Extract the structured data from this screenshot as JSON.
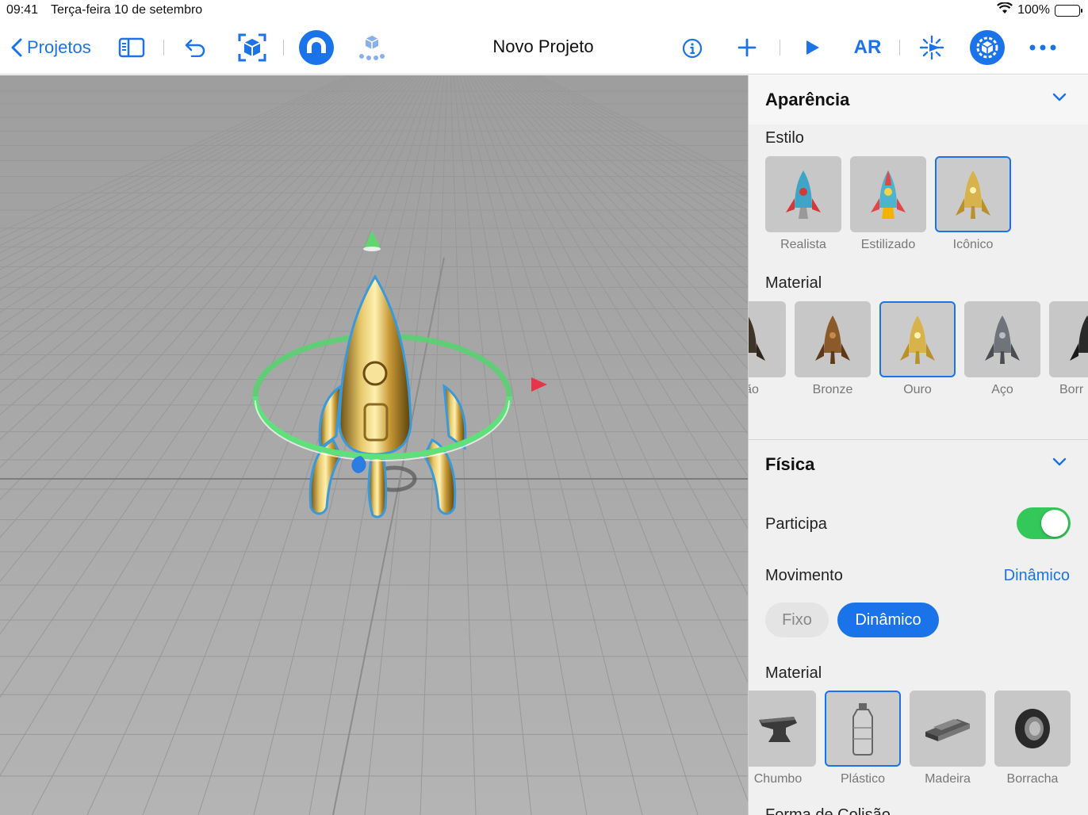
{
  "status": {
    "time": "09:41",
    "date": "Terça-feira 10 de setembro",
    "battery": "100%"
  },
  "toolbar": {
    "back_label": "Projetos",
    "title": "Novo Projeto",
    "ar_label": "AR"
  },
  "inspector": {
    "appearance": {
      "title": "Aparência",
      "style_label": "Estilo",
      "styles": [
        "Realista",
        "Estilizado",
        "Icônico"
      ],
      "selected_style": "Icônico",
      "material_label": "Material",
      "materials": [
        "ão",
        "Bronze",
        "Ouro",
        "Aço",
        "Borr"
      ],
      "selected_material": "Ouro"
    },
    "physics": {
      "title": "Física",
      "participate_label": "Participa",
      "participate_on": true,
      "movement_label": "Movimento",
      "movement_value": "Dinâmico",
      "segments": [
        "Fixo",
        "Dinâmico"
      ],
      "material_label": "Material",
      "materials": [
        "Chumbo",
        "Plástico",
        "Madeira",
        "Borracha"
      ],
      "selected_material": "Plástico",
      "next_label_partial": "Forma de Colisão"
    }
  },
  "colors": {
    "accent": "#1a73e8",
    "toggle_on": "#34c759",
    "gizmo_y": "#4cd964",
    "gizmo_x": "#e8344a",
    "gizmo_z": "#2a7de1"
  }
}
